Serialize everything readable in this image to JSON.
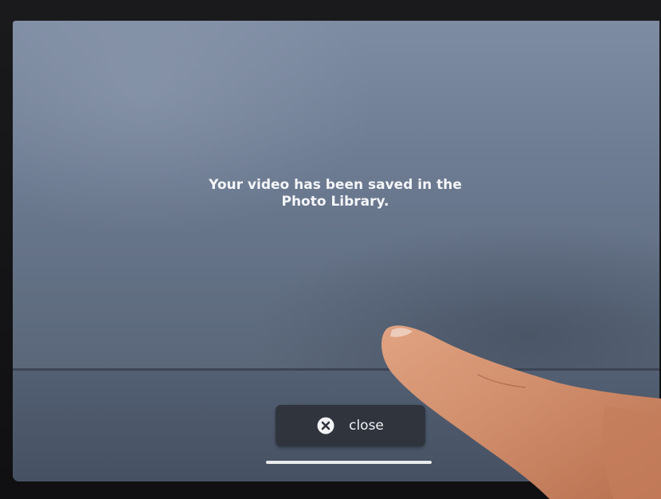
{
  "dialog": {
    "message": "Your video has been saved in the Photo Library."
  },
  "close_button": {
    "label": "close",
    "icon": "close-icon"
  },
  "colors": {
    "screen": "#6b798f",
    "button": "#2f343d",
    "text": "#f4f6f8"
  }
}
